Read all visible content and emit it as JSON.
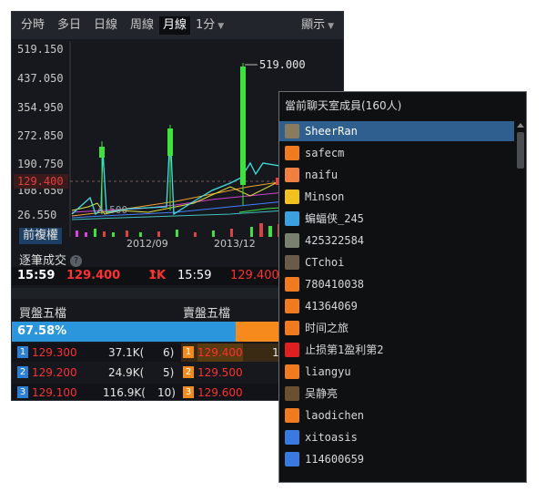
{
  "toolbar": {
    "tabs": [
      "分時",
      "多日",
      "日線",
      "周線",
      "月線"
    ],
    "active_tab": "月線",
    "interval": "1分",
    "display": "顯示"
  },
  "chart": {
    "y_ticks": [
      "519.150",
      "437.050",
      "354.950",
      "272.850",
      "190.750",
      "108.650",
      "26.550"
    ],
    "current_price": "129.400",
    "peak_label": "519.000",
    "marker_label": "4.500",
    "x_ticks": [
      "2012/09",
      "2013/12"
    ],
    "adjust_button": "前複權"
  },
  "trades": {
    "title": "逐筆成交",
    "time": "15:59",
    "price": "129.400",
    "volume": "1K",
    "time2": "15:59",
    "price2": "129.400"
  },
  "orderbook": {
    "buy_title": "買盤五檔",
    "sell_title": "賣盤五檔",
    "ratio_text": "67.58%",
    "buy_ratio": 0.6758,
    "rows": [
      {
        "n": "1",
        "bid": "129.300",
        "bid_vol": "37.1K(",
        "bid_cnt": "6)",
        "ask": "129.400",
        "ask_vol": "1"
      },
      {
        "n": "2",
        "bid": "129.200",
        "bid_vol": "24.9K(",
        "bid_cnt": "5)",
        "ask": "129.500",
        "ask_vol": ""
      },
      {
        "n": "3",
        "bid": "129.100",
        "bid_vol": "116.9K(",
        "bid_cnt": "10)",
        "ask": "129.600",
        "ask_vol": ""
      }
    ]
  },
  "chat": {
    "title": "當前聊天室成員(160人)",
    "members": [
      {
        "name": "SheerRan",
        "color": "#8a7a60"
      },
      {
        "name": "safecm",
        "color": "#f07a20"
      },
      {
        "name": "naifu",
        "color": "#f08040"
      },
      {
        "name": "Minson",
        "color": "#f0c020"
      },
      {
        "name": "蝙蝠侠_245",
        "color": "#3aa0e0"
      },
      {
        "name": "425322584",
        "color": "#7a8070"
      },
      {
        "name": "CTchoi",
        "color": "#6a5a4a"
      },
      {
        "name": "780410038",
        "color": "#f07a20"
      },
      {
        "name": "41364069",
        "color": "#f07a20"
      },
      {
        "name": "时间之旅",
        "color": "#f07a20"
      },
      {
        "name": "止损第1盈利第2",
        "color": "#e02020"
      },
      {
        "name": "liangyu",
        "color": "#f07a20"
      },
      {
        "name": "吴静亮",
        "color": "#6a5030"
      },
      {
        "name": "laodichen",
        "color": "#f07a20"
      },
      {
        "name": "xitoasis",
        "color": "#3a7ae0"
      },
      {
        "name": "114600659",
        "color": "#3a7ae0"
      }
    ]
  }
}
